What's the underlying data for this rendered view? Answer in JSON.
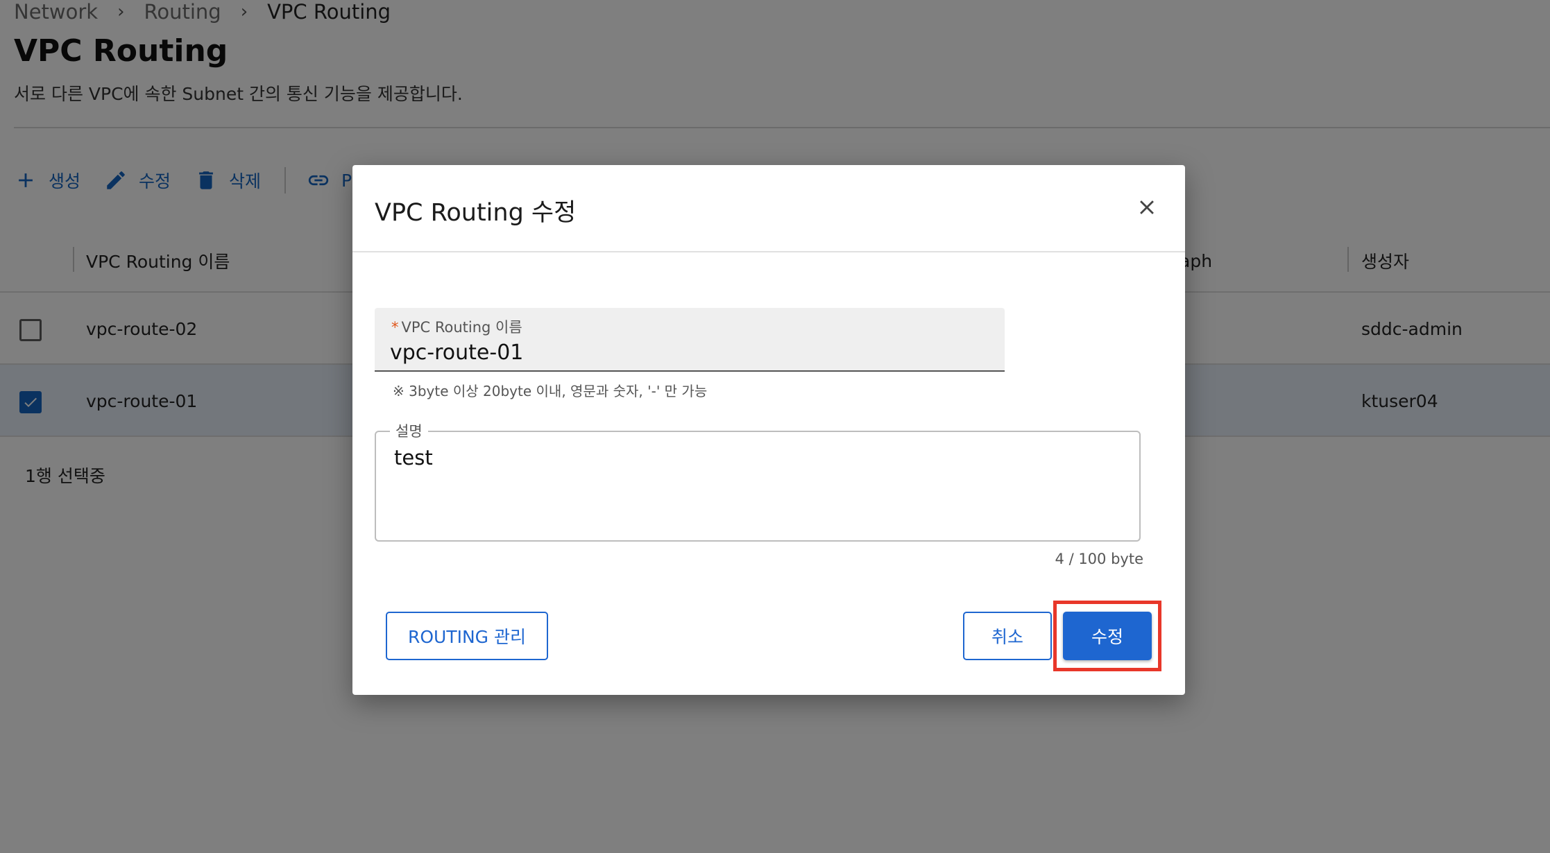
{
  "breadcrumb": [
    "Network",
    "Routing",
    "VPC Routing"
  ],
  "page": {
    "title": "VPC Routing",
    "description": "서로 다른 VPC에 속한 Subnet 간의 통신 기능을 제공합니다."
  },
  "toolbar": {
    "create_label": "생성",
    "edit_label": "수정",
    "delete_label": "삭제",
    "partial_label": "P"
  },
  "table": {
    "columns": {
      "name": "VPC Routing 이름",
      "graph_partial": "aph",
      "creator": "생성자"
    },
    "rows": [
      {
        "name": "vpc-route-02",
        "creator": "sddc-admin",
        "checked": false
      },
      {
        "name": "vpc-route-01",
        "creator": "ktuser04",
        "checked": true
      }
    ],
    "selection_status": "1행 선택중"
  },
  "dialog": {
    "title": "VPC Routing 수정",
    "name_field": {
      "label": "VPC Routing 이름",
      "required_mark": "*",
      "value": "vpc-route-01",
      "hint": "※ 3byte 이상 20byte 이내, 영문과 숫자, '-' 만 가능"
    },
    "description_field": {
      "label": "설명",
      "value": "test",
      "counter": "4 / 100 byte"
    },
    "buttons": {
      "routing_manage": "ROUTING 관리",
      "cancel": "취소",
      "submit": "수정"
    }
  },
  "colors": {
    "primary": "#1e66d0",
    "highlight": "#e8372a",
    "required": "#e0561b",
    "selected_row": "#e7eef8"
  }
}
